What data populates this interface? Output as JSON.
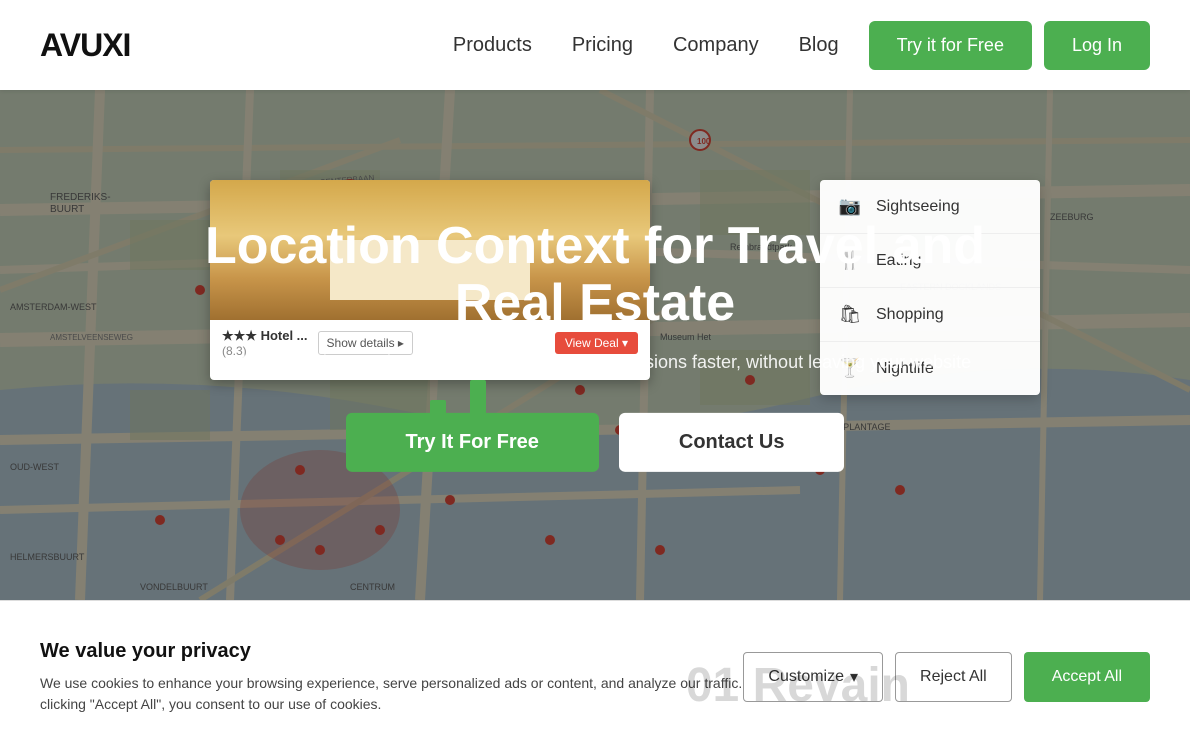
{
  "logo": {
    "text": "AVUXI"
  },
  "navbar": {
    "links": [
      {
        "label": "Products",
        "id": "products"
      },
      {
        "label": "Pricing",
        "id": "pricing"
      },
      {
        "label": "Company",
        "id": "company"
      },
      {
        "label": "Blog",
        "id": "blog"
      }
    ],
    "try_free_label": "Try it for Free",
    "login_label": "Log In"
  },
  "hero": {
    "title": "Location Context for Travel and Real Estate",
    "subtitle": "Help your visitors make the best accommodation decisions faster, without leaving your website",
    "try_free_label": "Try It For Free",
    "contact_label": "Contact Us"
  },
  "hotel_card": {
    "name": "★★★ Hotel ...",
    "review": "(8.3)",
    "show_details": "Show details ▸",
    "view_deal": "View Deal  ▾"
  },
  "poi_panel": {
    "items": [
      {
        "icon": "📷",
        "label": "Sightseeing"
      },
      {
        "icon": "🍴",
        "label": "Eating"
      },
      {
        "icon": "🛍",
        "label": "Shopping"
      },
      {
        "icon": "🍸",
        "label": "Nightlife"
      }
    ]
  },
  "cookie": {
    "title": "We value your privacy",
    "text": "We use cookies to enhance your browsing experience, serve personalized ads or content, and analyze our traffic. By clicking \"Accept All\", you consent to our use of cookies.",
    "custom_label": "Customize",
    "reject_label": "Reject All",
    "accept_label": "Accept All"
  },
  "revain": {
    "text": "01 Revain"
  }
}
